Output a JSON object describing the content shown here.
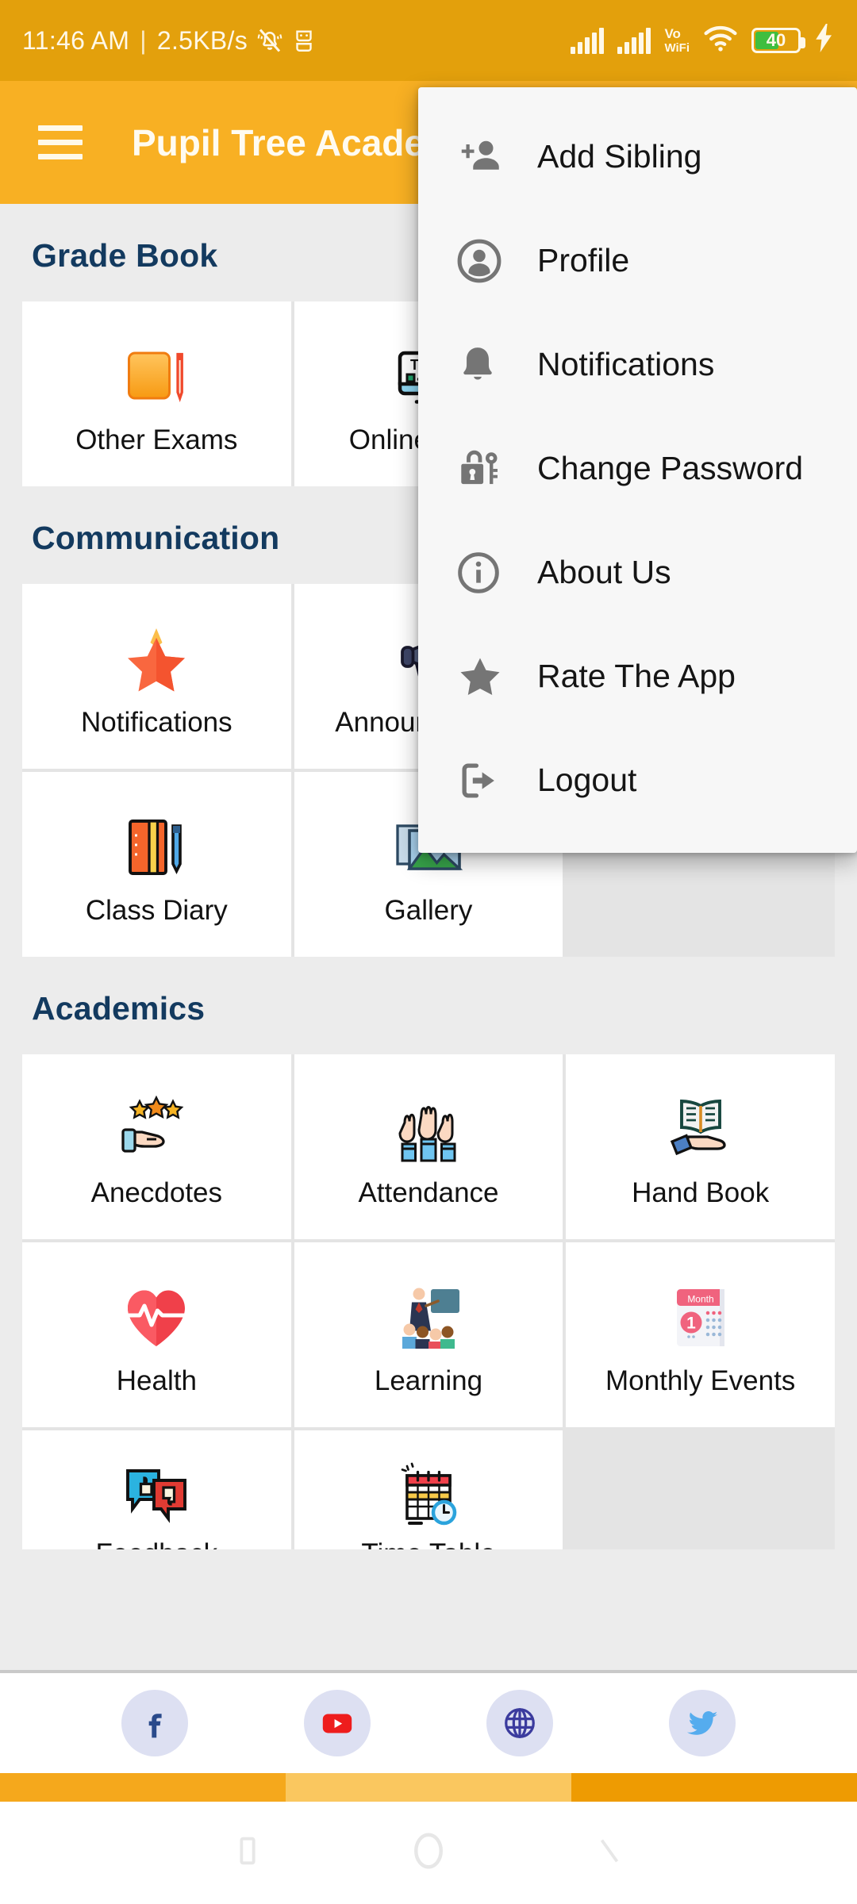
{
  "status_bar": {
    "time": "11:46 AM",
    "separator": "|",
    "network_speed": "2.5KB/s",
    "mute_icon": "bell-mute-icon",
    "chip_icon": "screen-recorder-icon",
    "signal1_icon": "signal-bars-icon",
    "signal2_icon": "signal-bars-icon",
    "vowifi_line1": "Vo",
    "vowifi_line2": "WiFi",
    "wifi_icon": "wifi-icon",
    "battery_level": "40",
    "charging_icon": "lightning-bolt-icon"
  },
  "app_bar": {
    "menu_icon": "hamburger-menu-icon",
    "title": "Pupil Tree Academy"
  },
  "overflow_menu": {
    "items": [
      {
        "label": "Add Sibling",
        "icon": "add-person-icon"
      },
      {
        "label": "Profile",
        "icon": "user-circle-icon"
      },
      {
        "label": "Notifications",
        "icon": "bell-icon"
      },
      {
        "label": "Change Password",
        "icon": "lock-key-icon"
      },
      {
        "label": "About Us",
        "icon": "info-circle-icon"
      },
      {
        "label": "Rate The App",
        "icon": "star-icon"
      },
      {
        "label": "Logout",
        "icon": "logout-arrow-icon"
      }
    ]
  },
  "sections": [
    {
      "title": "Grade Book",
      "tiles": [
        {
          "label": "Other Exams",
          "icon": "notebook-pencil-icon"
        },
        {
          "label": "Online Exam",
          "icon": "monitor-test-icon"
        },
        {
          "label": "",
          "icon": ""
        }
      ]
    },
    {
      "title": "Communication",
      "tiles": [
        {
          "label": "Notifications",
          "icon": "star-burst-icon"
        },
        {
          "label": "Announcement",
          "icon": "megaphone-icon"
        },
        {
          "label": "",
          "icon": ""
        },
        {
          "label": "Class Diary",
          "icon": "diary-pen-icon"
        },
        {
          "label": "Gallery",
          "icon": "photo-stack-icon"
        },
        {
          "label": "",
          "icon": ""
        }
      ]
    },
    {
      "title": "Academics",
      "tiles": [
        {
          "label": "Anecdotes",
          "icon": "hand-three-stars-icon"
        },
        {
          "label": "Attendance",
          "icon": "raised-hands-icon"
        },
        {
          "label": "Hand Book",
          "icon": "open-book-hand-icon"
        },
        {
          "label": "Health",
          "icon": "heart-pulse-icon"
        },
        {
          "label": "Learning",
          "icon": "teacher-class-icon"
        },
        {
          "label": "Monthly Events",
          "icon": "calendar-month-icon"
        },
        {
          "label": "Feedback",
          "icon": "thumbs-bubbles-icon"
        },
        {
          "label": "Time Table",
          "icon": "calendar-clock-icon"
        },
        {
          "label": "",
          "icon": ""
        }
      ]
    }
  ],
  "social_bar": {
    "items": [
      {
        "name": "facebook",
        "icon": "facebook-icon"
      },
      {
        "name": "youtube",
        "icon": "youtube-icon"
      },
      {
        "name": "website",
        "icon": "globe-icon"
      },
      {
        "name": "twitter",
        "icon": "twitter-icon"
      }
    ]
  },
  "nav_bar": {
    "back_icon": "back-icon",
    "home_icon": "home-icon",
    "recents_icon": "recents-icon"
  },
  "colors": {
    "status_bar": "#E3A00C",
    "app_bar": "#F8B023",
    "section_title": "#133A5F",
    "page_background": "#ECECEC",
    "tile_background": "#FFFFFF",
    "battery_fill": "#3FBE3F",
    "strip_1": "#F5A81C",
    "strip_2": "#FAC75F",
    "strip_3": "#EE9B02"
  }
}
